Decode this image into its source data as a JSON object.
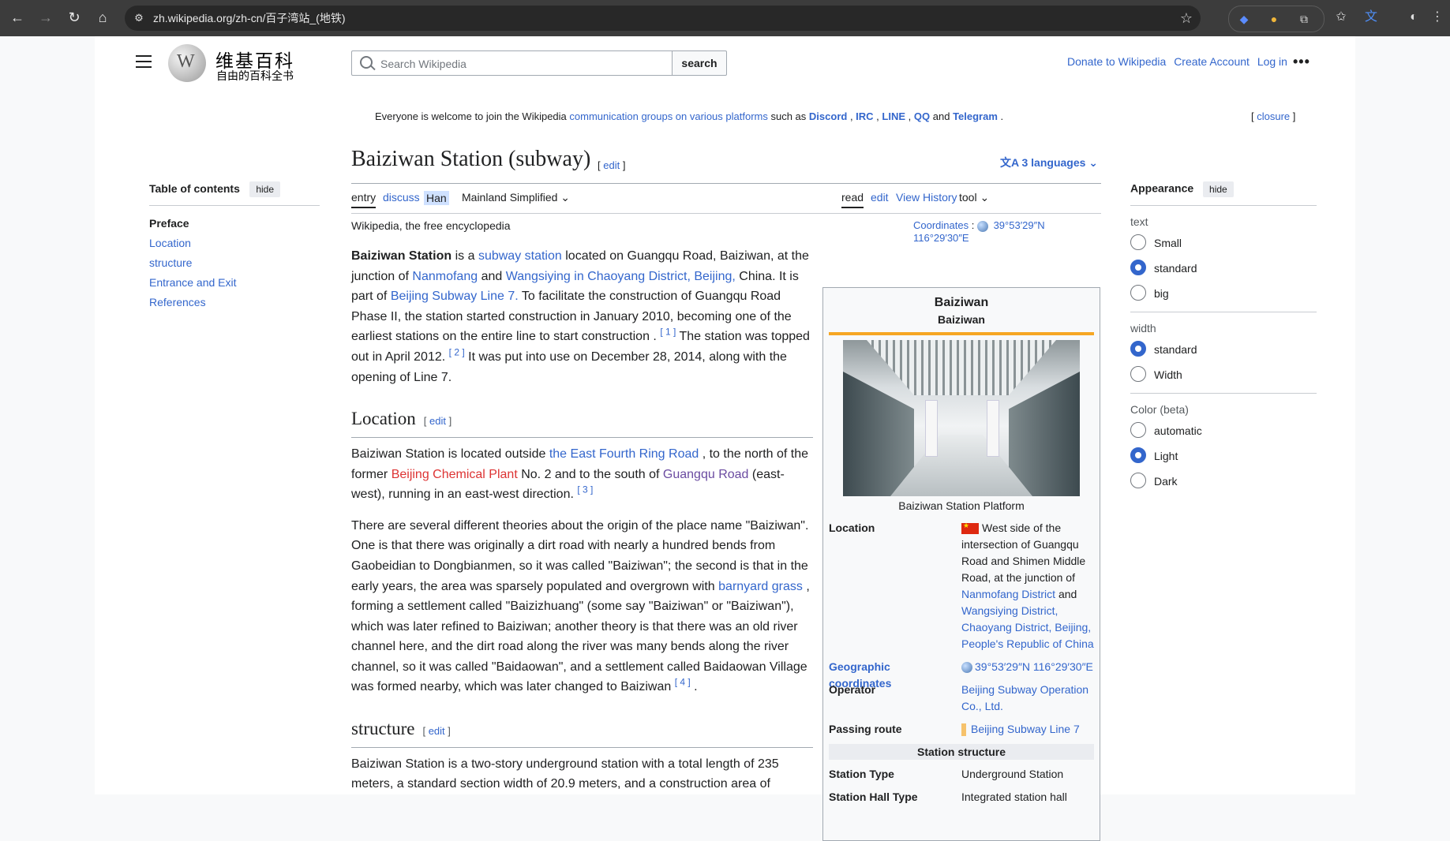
{
  "browser": {
    "url": "zh.wikipedia.org/zh-cn/百子湾站_(地铁)"
  },
  "header": {
    "logo_title": "维基百科",
    "logo_tagline": "自由的百科全书",
    "search_placeholder": "Search Wikipedia",
    "search_button": "search",
    "user_links": [
      "Donate to Wikipedia",
      "Create Account",
      "Log in"
    ]
  },
  "sitenotice": {
    "prefix": "Everyone is welcome to join the Wikipedia",
    "link": "communication groups on various platforms",
    "such_as": "such as",
    "platforms": [
      "Discord",
      "IRC",
      "LINE",
      "QQ"
    ],
    "and": "and",
    "last": "Telegram",
    "end": ".",
    "closure": "closure"
  },
  "toc": {
    "title": "Table of contents",
    "hide": "hide",
    "items": [
      "Preface",
      "Location",
      "structure",
      "Entrance and Exit",
      "References"
    ]
  },
  "article": {
    "title": "Baiziwan Station (subway)",
    "edit": "edit",
    "languages": "3 languages",
    "tabs_left": [
      "entry",
      "discuss",
      "Han",
      "Mainland Simplified"
    ],
    "tabs_right": [
      "read",
      "edit",
      "View History",
      "tool"
    ],
    "tagline": "Wikipedia, the free encyclopedia",
    "coords_label": "Coordinates",
    "coords_value": "39°53′29″N 116°29′30″E",
    "intro": {
      "b": "Baiziwan Station",
      "t1": "is a",
      "l1": "subway station",
      "t2": "located on Guangqu Road, Baiziwan, at the junction of",
      "l2": "Nanmofang",
      "t3": "and",
      "l3": "Wangsiying in Chaoyang District, Beijing,",
      "t4": "China. It is part of",
      "l4": "Beijing Subway Line 7.",
      "t5": "To facilitate the construction of Guangqu Road Phase II, the station started construction in January 2010, becoming one of the earliest stations on the entire line to start construction .",
      "r1": "[ 1 ]",
      "t6": "The station was topped out in April 2012.",
      "r2": "[ 2 ]",
      "t7": "It was put into use on December 28, 2014, along with the opening of Line 7."
    },
    "location": {
      "heading": "Location",
      "edit": "edit",
      "t1": "Baiziwan Station is located outside",
      "l1": "the East Fourth Ring Road",
      "t2": ", to the north of the former",
      "l2": "Beijing Chemical Plant",
      "t3": "No. 2 and to the south of",
      "l3": "Guangqu Road",
      "t4": "(east-west), running in an east-west direction.",
      "r3": "[ 3 ]",
      "p2a": "There are several different theories about the origin of the place name \"Baiziwan\". One is that there was originally a dirt road with nearly a hundred bends from Gaobeidian to Dongbianmen, so it was called \"Baiziwan\"; the second is that in the early years, the area was sparsely populated and overgrown with",
      "p2l": "barnyard grass",
      "p2b": ", forming a settlement called \"Baizizhuang\" (some say \"Baiziwan\" or \"Baiziwan\"), which was later refined to Baiziwan; another theory is that there was an old river channel here, and the dirt road along the river was many bends along the river channel, so it was called \"Baidaowan\", and a settlement called Baidaowan Village was formed nearby, which was later changed to Baiziwan",
      "r4": "[ 4 ]",
      "p2c": "."
    },
    "structure": {
      "heading": "structure",
      "edit": "edit",
      "text": "Baiziwan Station is a two-story underground station with a total length of 235 meters, a standard section width of 20.9 meters, and a construction area of"
    }
  },
  "infobox": {
    "title": "Baiziwan",
    "subtitle": "Baiziwan",
    "caption": "Baiziwan Station Platform",
    "location_label": "Location",
    "location_text": "West side of the intersection of Guangqu Road and Shimen Middle Road, at the junction of",
    "location_l1": "Nanmofang District",
    "location_and": "and",
    "location_l2": "Wangsiying District, Chaoyang District, Beijing, People's Republic of China",
    "geo_label": "Geographic coordinates",
    "geo_value": "39°53′29″N 116°29′30″E",
    "operator_label": "Operator",
    "operator_value": "Beijing Subway Operation Co., Ltd.",
    "route_label": "Passing route",
    "route_value": "Beijing Subway Line 7",
    "section_header": "Station structure",
    "type_label": "Station Type",
    "type_value": "Underground Station",
    "hall_label": "Station Hall Type",
    "hall_value": "Integrated station hall",
    "accent_color": "#f6a623"
  },
  "appearance": {
    "title": "Appearance",
    "hide": "hide",
    "text_label": "text",
    "text_options": [
      "Small",
      "standard",
      "big"
    ],
    "width_label": "width",
    "width_options": [
      "standard",
      "Width"
    ],
    "color_label": "Color (beta)",
    "color_options": [
      "automatic",
      "Light",
      "Dark"
    ]
  }
}
